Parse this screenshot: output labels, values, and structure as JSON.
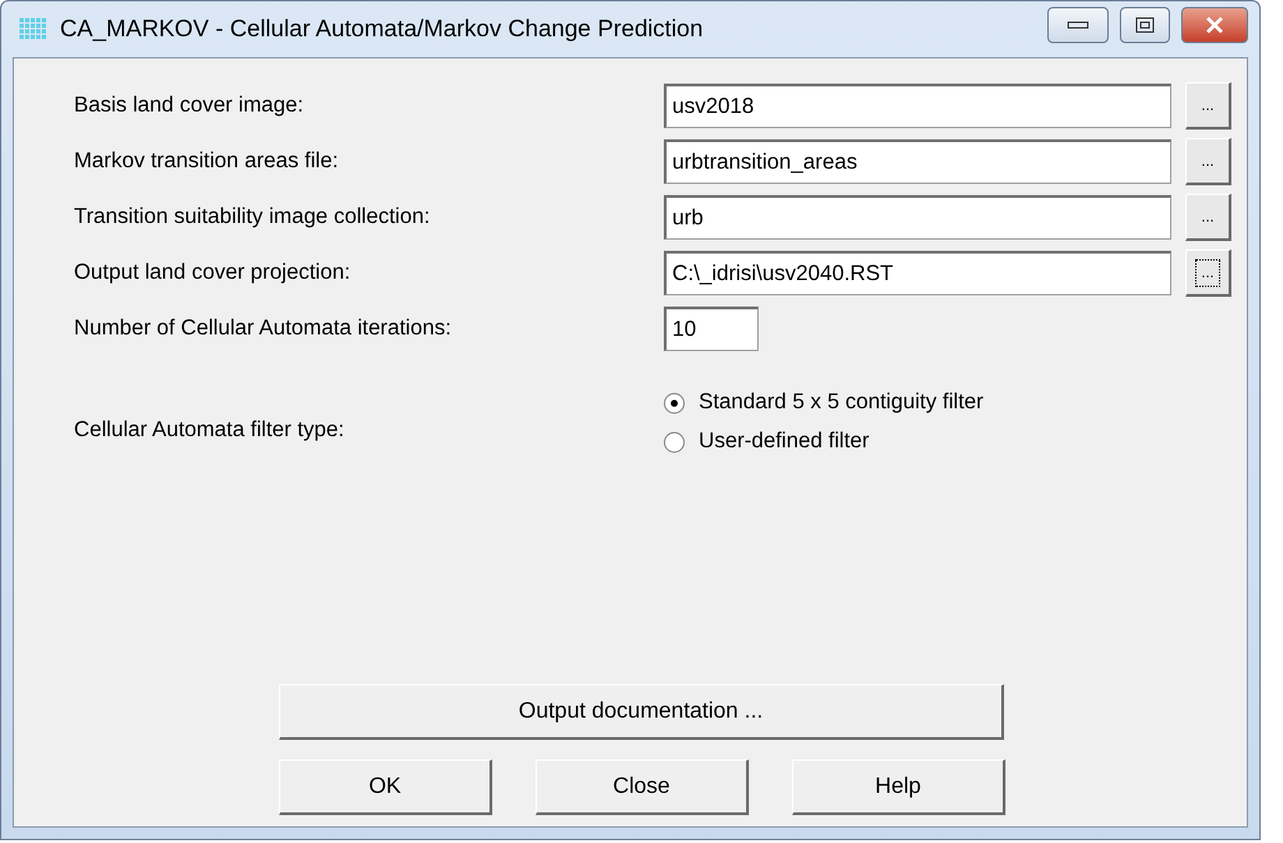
{
  "window": {
    "title": "CA_MARKOV - Cellular Automata/Markov Change Prediction"
  },
  "file_fields": [
    {
      "label": "Basis land cover image:",
      "value": "usv2018",
      "browse": "...",
      "focused": false
    },
    {
      "label": "Markov transition areas file:",
      "value": "urbtransition_areas",
      "browse": "...",
      "focused": false
    },
    {
      "label": "Transition suitability image collection:",
      "value": "urb",
      "browse": "...",
      "focused": false
    },
    {
      "label": "Output land cover projection:",
      "value": "C:\\_idrisi\\usv2040.RST",
      "browse": "...",
      "focused": true
    }
  ],
  "iterations": {
    "label": "Number of Cellular Automata iterations:",
    "value": "10"
  },
  "filter": {
    "label": "Cellular Automata filter type:",
    "options": [
      {
        "label": "Standard 5 x 5 contiguity filter",
        "selected": true
      },
      {
        "label": "User-defined filter",
        "selected": false
      }
    ]
  },
  "doc_button": "Output documentation ...",
  "buttons": [
    "OK",
    "Close",
    "Help"
  ]
}
